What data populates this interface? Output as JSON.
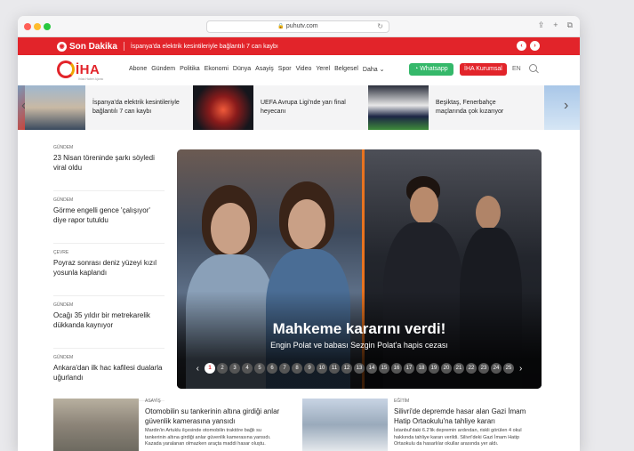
{
  "browser": {
    "url": "puhutv.com"
  },
  "breaking": {
    "label": "Son Dakika",
    "text": "İspanya'da elektrik kesintileriyle bağlantılı 7 can kaybı"
  },
  "header": {
    "logo_text": "İHA",
    "logo_sub": "İhlas Haber Ajansı",
    "menu": [
      "Abone",
      "Gündem",
      "Politika",
      "Ekonomi",
      "Dünya",
      "Asayiş",
      "Spor",
      "Video",
      "Yerel",
      "Belgesel",
      "Daha"
    ],
    "whatsapp_label": "Whatsapp",
    "kurumsal_label": "İHA Kurumsal",
    "lang": "EN"
  },
  "strip": [
    {
      "caption": "İspanya'da elektrik kesintileriyle bağlantılı 7 can kaybı"
    },
    {
      "caption": "UEFA Avrupa Ligi'nde yarı final heyecanı"
    },
    {
      "caption": "Beşiktaş, Fenerbahçe maçlarında çok kızarıyor"
    }
  ],
  "left_news": [
    {
      "category": "GÜNDEM",
      "title": "23 Nisan töreninde şarkı söyledi viral oldu"
    },
    {
      "category": "GÜNDEM",
      "title": "Görme engelli gence 'çalışıyor' diye rapor tutuldu"
    },
    {
      "category": "ÇEVRE",
      "title": "Poyraz sonrası deniz yüzeyi kızıl yosunla kaplandı"
    },
    {
      "category": "GÜNDEM",
      "title": "Ocağı 35 yıldır bir metrekarelik dükkanda kaynıyor"
    },
    {
      "category": "GÜNDEM",
      "title": "Ankara'dan ilk hac kafilesi dualarla uğurlandı"
    }
  ],
  "hero": {
    "title": "Mahkeme kararını verdi!",
    "subtitle": "Engin Polat ve babası Sezgin Polat'a hapis cezası",
    "pages": [
      "1",
      "2",
      "3",
      "4",
      "5",
      "6",
      "7",
      "8",
      "9",
      "10",
      "11",
      "12",
      "13",
      "14",
      "15",
      "16",
      "17",
      "18",
      "19",
      "20",
      "21",
      "22",
      "23",
      "24",
      "25"
    ],
    "active_page": "1"
  },
  "articles": [
    {
      "category": "ASAYİŞ",
      "title": "Otomobilin su tankerinin altına girdiği anlar güvenlik kamerasına yansıdı",
      "desc": "Mardin'in Artuklu ilçesinde otomobilin traktöre bağlı su tankerinin altına girdiği anlar güvenlik kamerasına yansıdı. Kazada yaralanan olmazken araçta maddi hasar oluştu."
    },
    {
      "category": "EĞİTİM",
      "title": "Silivri'de depremde hasar alan Gazi İmam Hatip Ortaokulu'na tahliye kararı",
      "desc": "İstanbul'daki 6.2'lik depremin ardından, riskli görülen 4 okul hakkında tahliye kararı verildi. Silivri'deki Gazi İmam Hatip Ortaokulu da hasarlılar okullar arasında yer aldı."
    }
  ]
}
